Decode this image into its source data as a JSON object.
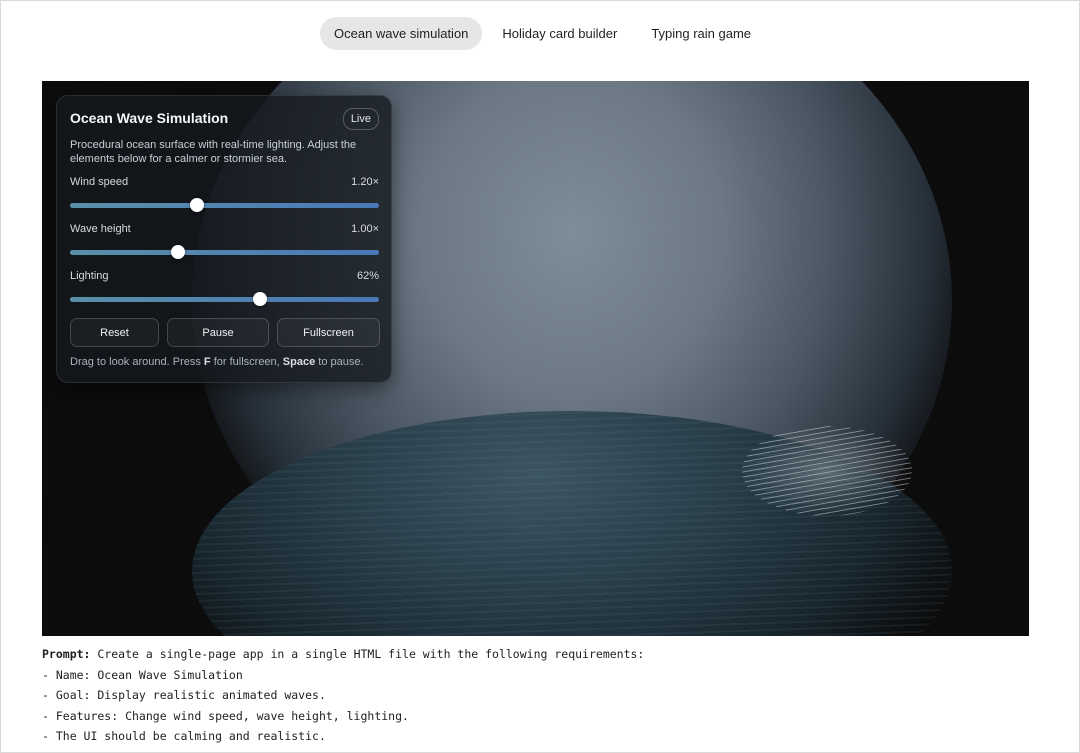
{
  "tabs": [
    {
      "label": "Ocean wave simulation",
      "active": true
    },
    {
      "label": "Holiday card builder",
      "active": false
    },
    {
      "label": "Typing rain game",
      "active": false
    }
  ],
  "panel": {
    "title": "Ocean Wave Simulation",
    "badge": "Live",
    "description": "Procedural ocean surface with real-time lighting. Adjust the elements below for a calmer or stormier sea.",
    "controls": [
      {
        "label": "Wind speed",
        "value_text": "1.20×",
        "fraction": 0.41
      },
      {
        "label": "Wave height",
        "value_text": "1.00×",
        "fraction": 0.35
      },
      {
        "label": "Lighting",
        "value_text": "62%",
        "fraction": 0.615
      }
    ],
    "buttons": {
      "reset": "Reset",
      "pause": "Pause",
      "fullscreen": "Fullscreen"
    },
    "hint": {
      "part1": "Drag to look around. Press ",
      "key1": "F",
      "part2": " for fullscreen, ",
      "key2": "Space",
      "part3": " to pause."
    }
  },
  "prompt": {
    "label": "Prompt:",
    "intro": " Create a single-page app in a single HTML file with the following requirements:",
    "lines": [
      "- Name: Ocean Wave Simulation",
      "- Goal: Display realistic animated waves.",
      "- Features: Change wind speed, wave height, lighting.",
      "- The UI should be calming and realistic."
    ]
  },
  "colors": {
    "accent_start": "#5b8fa8",
    "accent_end": "#4a78b8",
    "panel_bg": "#14181e",
    "active_tab_bg": "#e6e6e6"
  }
}
